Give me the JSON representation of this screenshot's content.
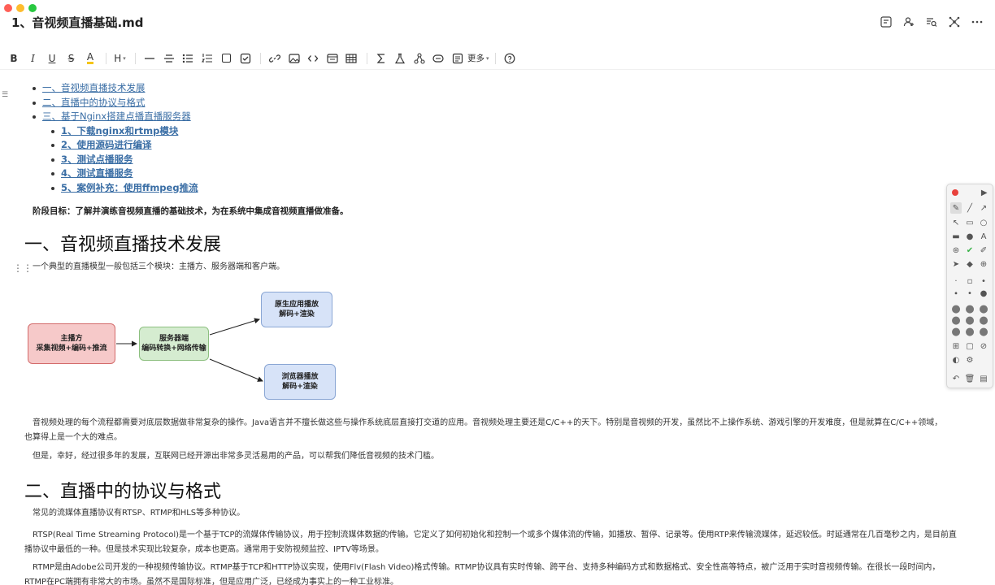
{
  "window": {
    "title": "1、音视频直播基础.md"
  },
  "top_actions": [
    "outline-icon",
    "share-person-icon",
    "search-lines-icon",
    "graph-icon",
    "more-icon"
  ],
  "toolbar": {
    "bold": "B",
    "italic": "I",
    "underline": "U",
    "strike": "S",
    "highlight": "A",
    "heading": "H",
    "more_label": "更多",
    "icons": [
      "hr-icon",
      "strikethrough-line-icon",
      "bullet-list-icon",
      "ordered-list-icon",
      "checkbox-icon",
      "checked-box-icon",
      "link-icon",
      "image-icon",
      "code-icon",
      "embed-icon",
      "table-icon",
      "sigma-icon",
      "flask-icon",
      "mindmap-icon",
      "card-icon",
      "quote-icon",
      "help-icon"
    ]
  },
  "toc": [
    {
      "label": "一、音视频直播技术发展",
      "level": 1
    },
    {
      "label": "二、直播中的协议与格式",
      "level": 1
    },
    {
      "label": "三、基于Nginx搭建点播直播服务器",
      "level": 1
    },
    {
      "label": "1、下载nginx和rtmp模块",
      "level": 2
    },
    {
      "label": "2、使用源码进行编译",
      "level": 2
    },
    {
      "label": "3、测试点播服务",
      "level": 2
    },
    {
      "label": "4、测试直播服务",
      "level": 2
    },
    {
      "label": "5、案例补充：使用ffmpeg推流",
      "level": 2
    }
  ],
  "goal": "阶段目标：了解并演练音视频直播的基础技术，为在系统中集成音视频直播做准备。",
  "section1": {
    "heading": "一、音视频直播技术发展",
    "intro": "一个典型的直播模型一般包括三个模块：主播方、服务器端和客户端。",
    "p1": "音视频处理的每个流程都需要对底层数据做非常复杂的操作。Java语言并不擅长做这些与操作系统底层直接打交道的应用。音视频处理主要还是C/C++的天下。特别是音视频的开发，虽然比不上操作系统、游戏引擎的开发难度，但是就算在C/C++领域，",
    "p1b": "也算得上是一个大的难点。",
    "p2": "但是，幸好，经过很多年的发展，互联网已经开源出非常多灵活易用的产品，可以帮我们降低音视频的技术门槛。"
  },
  "diagram": {
    "anchor": {
      "line1": "主播方",
      "line2": "采集视频+编码+推流",
      "color": "#f6c9c9",
      "border": "#d36b6b"
    },
    "server": {
      "line1": "服务器端",
      "line2": "编码转换+网络传输",
      "color": "#d5ecd0",
      "border": "#8cbf7f"
    },
    "native": {
      "line1": "原生应用播放",
      "line2": "解码+渲染",
      "color": "#d7e3f8",
      "border": "#8aa6d4"
    },
    "browser": {
      "line1": "浏览器播放",
      "line2": "解码+渲染",
      "color": "#d7e3f8",
      "border": "#8aa6d4"
    }
  },
  "section2": {
    "heading": "二、直播中的协议与格式",
    "intro": "常见的流媒体直播协议有RTSP、RTMP和HLS等多种协议。",
    "rtsp_a": "RTSP(Real Time Streaming Protocol)是一个基于TCP的流媒体传输协议，用于控制流媒体数据的传输。它定义了如何初始化和控制一个或多个媒体流的传输，如播放、暂停、记录等。使用RTP来传输流媒体，延迟较低。时延通常在几百毫秒之内，是目前直",
    "rtsp_b": "播协议中最低的一种。但是技术实现比较复杂，成本也更高。通常用于安防视频监控、IPTV等场景。",
    "rtmp_a": "RTMP是由Adobe公司开发的一种视频传输协议。RTMP基于TCP和HTTP协议实现，使用Flv(Flash Video)格式传输。RTMP协议具有实时传输、跨平台、支持多种编码方式和数据格式、安全性高等特点，被广泛用于实时音视频传输。在很长一段时间内，",
    "rtmp_b": "RTMP在PC端拥有非常大的市场。虽然不是国际标准，但是应用广泛，已经成为事实上的一种工业标准。"
  },
  "palette": {
    "colors": {
      "record": "#e8413c"
    }
  }
}
